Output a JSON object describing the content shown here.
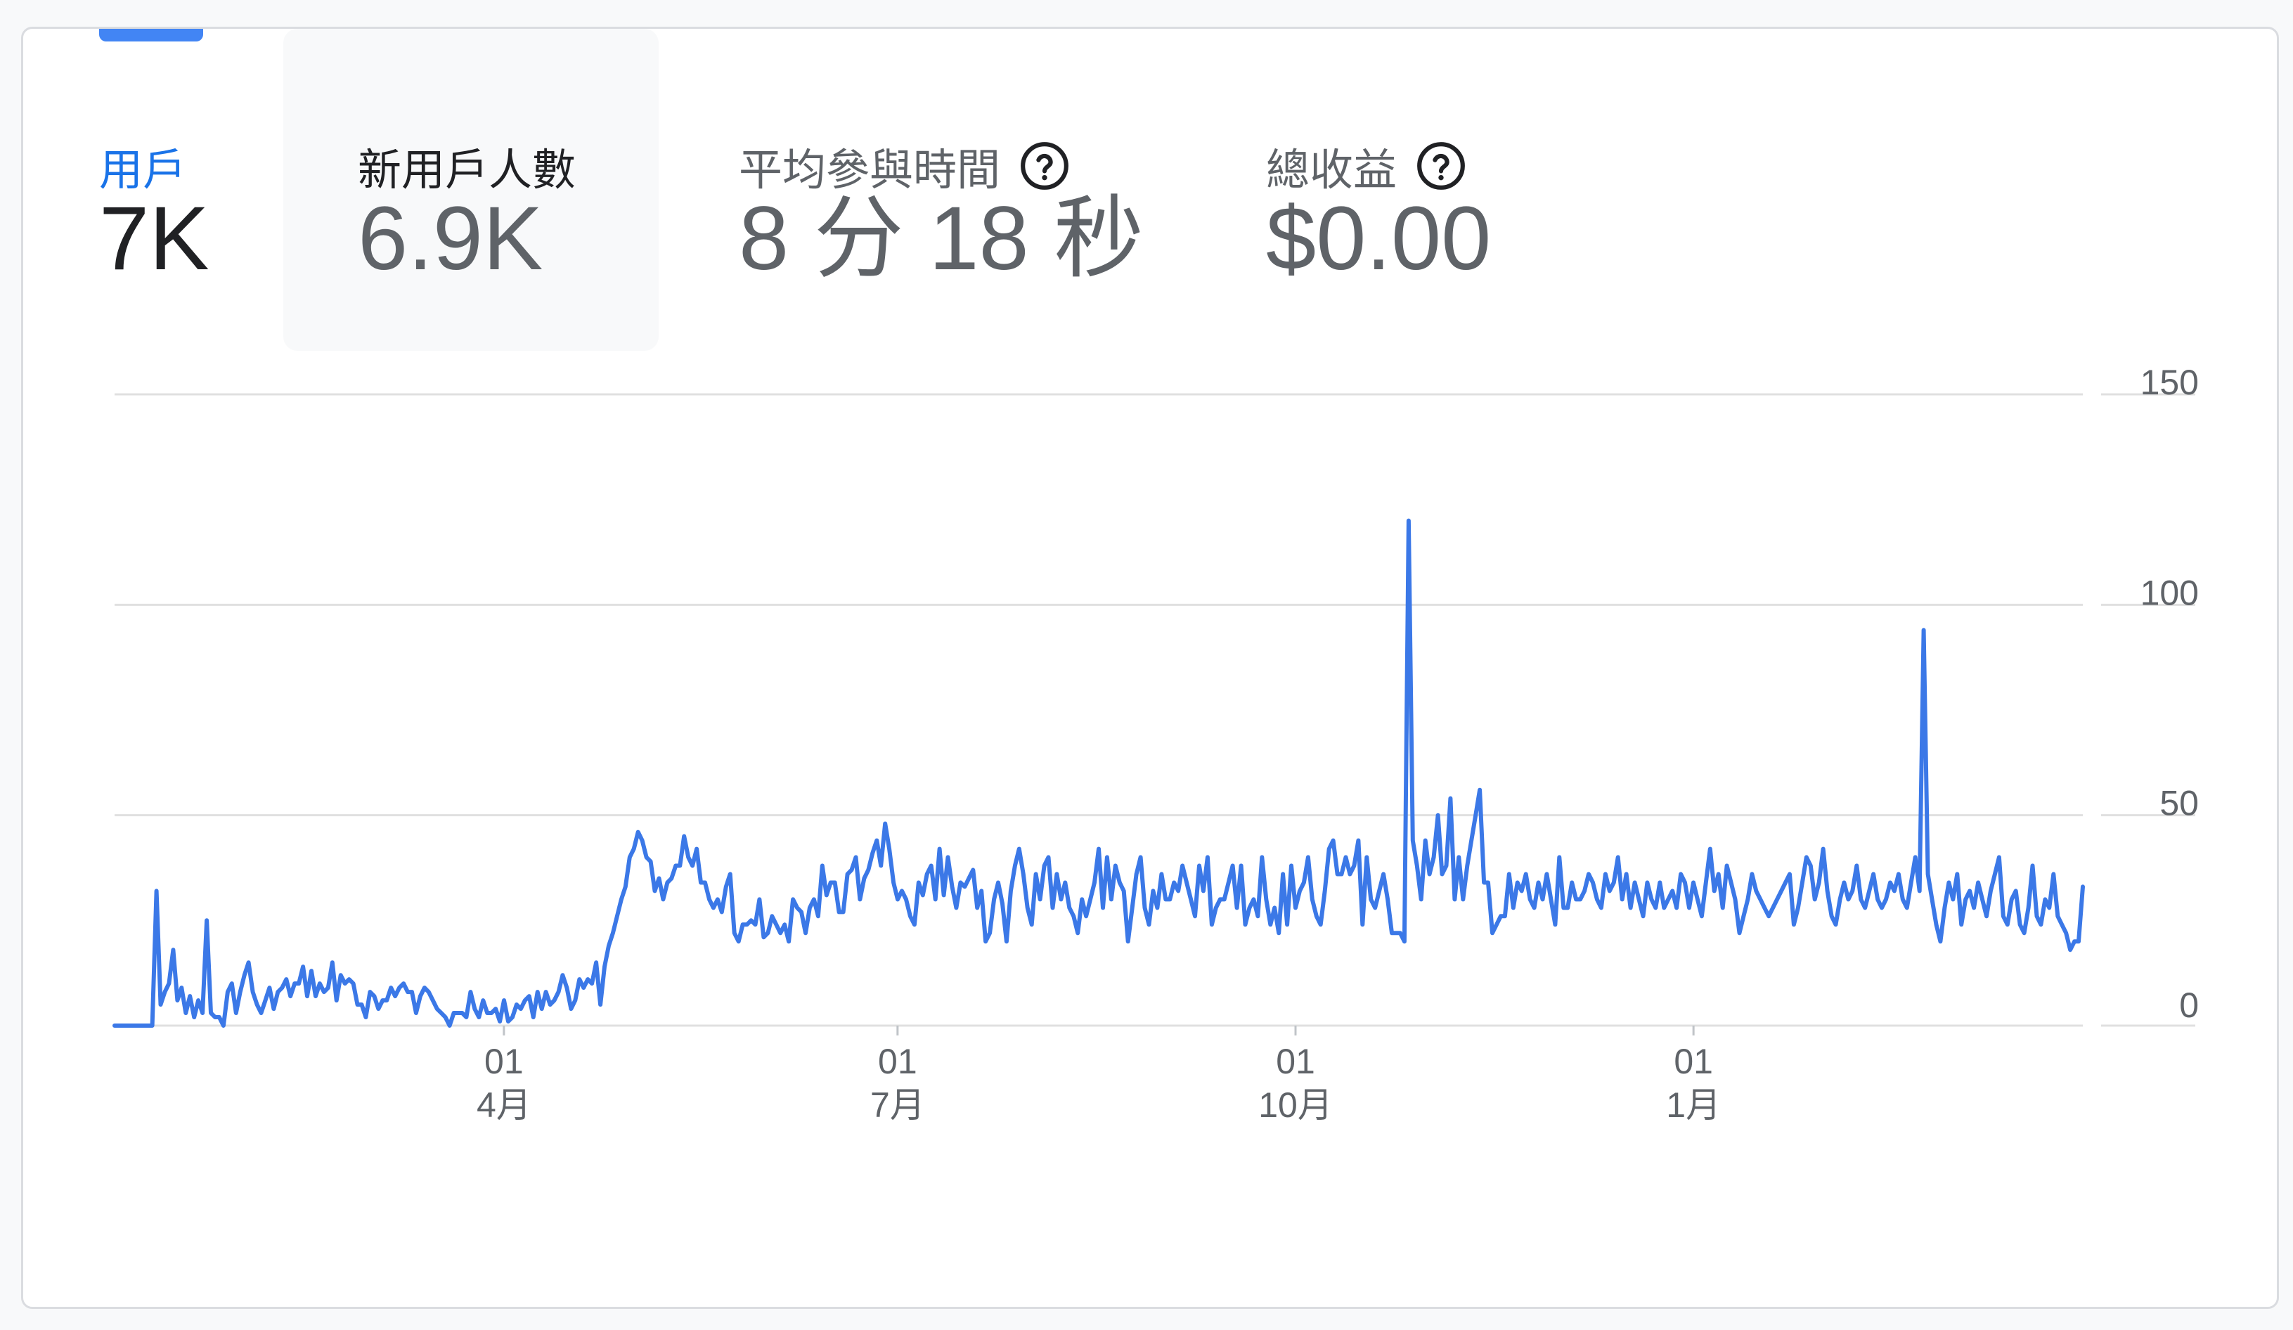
{
  "metrics": [
    {
      "label": "用戶",
      "value": "7K",
      "active": true,
      "has_help": false
    },
    {
      "label": "新用戶人數",
      "value": "6.9K",
      "active": false,
      "has_help": false
    },
    {
      "label": "平均參與時間",
      "value": "8 分 18 秒",
      "active": false,
      "has_help": true
    },
    {
      "label": "總收益",
      "value": "$0.00",
      "active": false,
      "has_help": true
    }
  ],
  "colors": {
    "accent": "#4285f4",
    "line": "#3b78e7",
    "grid": "#e0e0e0",
    "axis_text": "#5f6368"
  },
  "chart_data": {
    "type": "line",
    "title": "",
    "xlabel": "",
    "ylabel": "",
    "ylim": [
      0,
      150
    ],
    "y_ticks": [
      0,
      50,
      100,
      150
    ],
    "y_axis_position": "right",
    "grid": true,
    "x_ticks": [
      {
        "day": "01",
        "month": "4月"
      },
      {
        "day": "01",
        "month": "7月"
      },
      {
        "day": "01",
        "month": "10月"
      },
      {
        "day": "01",
        "month": "1月"
      }
    ],
    "x_start": "2023-01-01",
    "x_end": "2024-03-31",
    "series": [
      {
        "values": [
          0,
          0,
          0,
          0,
          0,
          0,
          0,
          0,
          0,
          0,
          32,
          5,
          8,
          10,
          18,
          6,
          9,
          3,
          7,
          2,
          6,
          3,
          25,
          3,
          2,
          2,
          0,
          8,
          10,
          3,
          8,
          12,
          15,
          8,
          5,
          3,
          6,
          9,
          4,
          8,
          9,
          11,
          7,
          10,
          10,
          14,
          7,
          13,
          7,
          10,
          8,
          9,
          15,
          6,
          12,
          10,
          11,
          10,
          5,
          5,
          2,
          8,
          7,
          4,
          6,
          6,
          9,
          7,
          9,
          10,
          8,
          8,
          3,
          7,
          9,
          8,
          6,
          4,
          3,
          2,
          0,
          3,
          3,
          3,
          2,
          8,
          4,
          2,
          6,
          3,
          3,
          4,
          1,
          6,
          1,
          2,
          5,
          4,
          6,
          7,
          2,
          8,
          4,
          8,
          5,
          6,
          8,
          12,
          9,
          4,
          6,
          11,
          9,
          11,
          10,
          15,
          5,
          14,
          19,
          22,
          26,
          30,
          33,
          40,
          42,
          46,
          44,
          40,
          39,
          32,
          35,
          30,
          34,
          35,
          38,
          38,
          45,
          40,
          38,
          42,
          34,
          34,
          30,
          28,
          30,
          27,
          33,
          36,
          22,
          20,
          24,
          24,
          25,
          24,
          30,
          21,
          22,
          26,
          24,
          22,
          24,
          20,
          30,
          28,
          27,
          22,
          28,
          30,
          26,
          38,
          31,
          34,
          34,
          27,
          27,
          36,
          37,
          40,
          30,
          35,
          37,
          41,
          44,
          38,
          48,
          42,
          34,
          30,
          32,
          30,
          26,
          24,
          34,
          31,
          36,
          38,
          30,
          42,
          31,
          40,
          33,
          28,
          34,
          33,
          35,
          37,
          28,
          32,
          20,
          22,
          30,
          34,
          29,
          20,
          32,
          38,
          42,
          36,
          28,
          24,
          36,
          30,
          38,
          40,
          28,
          36,
          30,
          34,
          28,
          26,
          22,
          30,
          26,
          30,
          34,
          42,
          28,
          40,
          30,
          38,
          34,
          32,
          20,
          28,
          36,
          40,
          28,
          24,
          32,
          28,
          36,
          30,
          30,
          34,
          32,
          38,
          34,
          30,
          26,
          38,
          32,
          40,
          24,
          28,
          30,
          30,
          34,
          38,
          28,
          38,
          24,
          28,
          30,
          26,
          40,
          30,
          24,
          28,
          22,
          36,
          24,
          38,
          28,
          32,
          34,
          40,
          30,
          26,
          24,
          32,
          42,
          44,
          36,
          36,
          40,
          36,
          38,
          44,
          24,
          40,
          30,
          28,
          32,
          36,
          30,
          22,
          22,
          22,
          20,
          120,
          44,
          38,
          30,
          44,
          36,
          40,
          50,
          36,
          38,
          54,
          30,
          40,
          30,
          38,
          44,
          50,
          56,
          34,
          34,
          22,
          24,
          26,
          26,
          36,
          28,
          34,
          32,
          36,
          30,
          28,
          34,
          30,
          36,
          30,
          24,
          40,
          28,
          28,
          34,
          30,
          30,
          32,
          36,
          34,
          30,
          28,
          36,
          32,
          34,
          40,
          30,
          36,
          28,
          34,
          30,
          26,
          34,
          30,
          28,
          34,
          28,
          30,
          32,
          28,
          36,
          34,
          28,
          34,
          30,
          26,
          34,
          42,
          32,
          36,
          28,
          38,
          34,
          30,
          22,
          26,
          30,
          36,
          32,
          30,
          28,
          26,
          28,
          30,
          32,
          34,
          36,
          24,
          28,
          34,
          40,
          38,
          30,
          34,
          42,
          32,
          26,
          24,
          30,
          34,
          30,
          32,
          38,
          30,
          28,
          32,
          36,
          30,
          28,
          30,
          34,
          32,
          36,
          30,
          28,
          34,
          40,
          32,
          94,
          36,
          30,
          24,
          20,
          28,
          34,
          30,
          36,
          24,
          30,
          32,
          28,
          34,
          30,
          26,
          32,
          36,
          40,
          26,
          24,
          30,
          32,
          24,
          22,
          28,
          38,
          26,
          24,
          30,
          28,
          36,
          26,
          24,
          22,
          18,
          20,
          20,
          33
        ]
      }
    ]
  }
}
